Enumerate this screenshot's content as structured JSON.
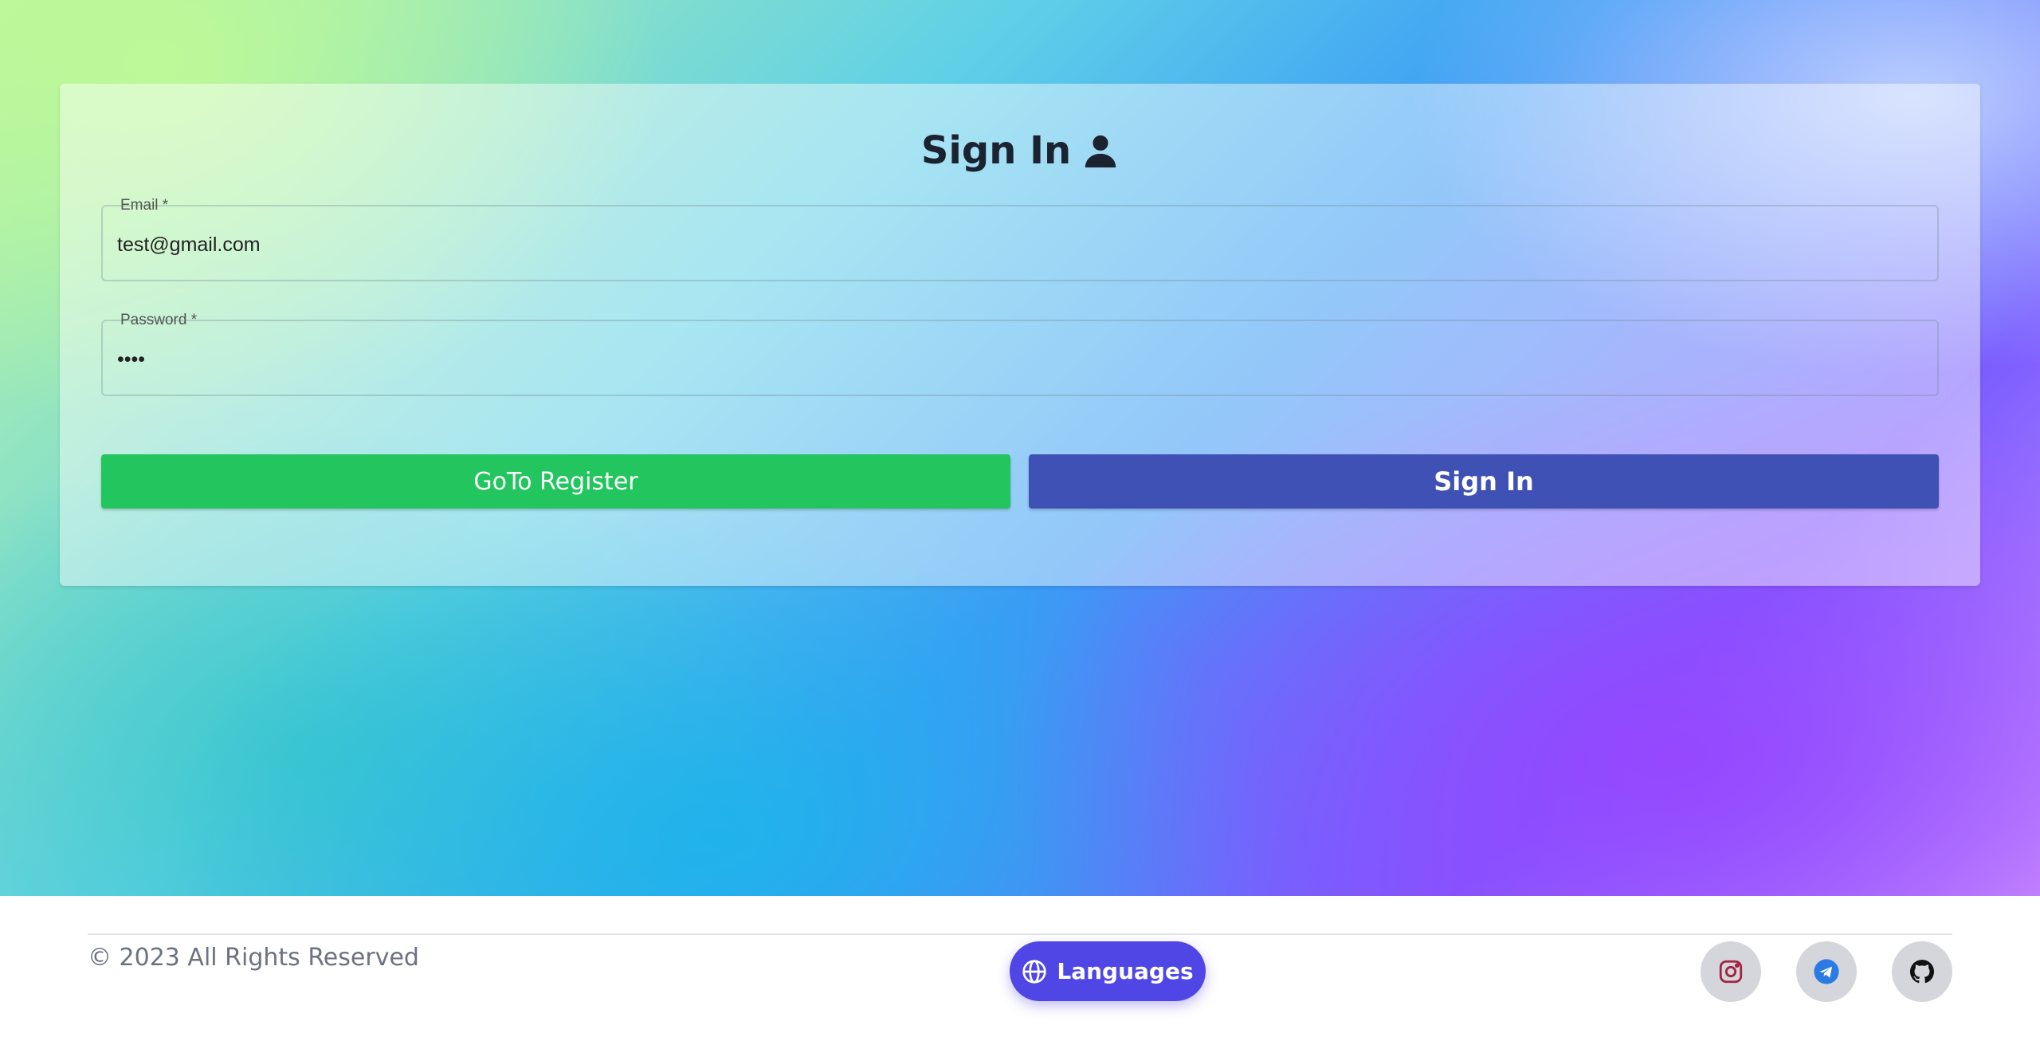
{
  "form": {
    "title": "Sign In",
    "email": {
      "label": "Email *",
      "value": "test@gmail.com"
    },
    "password": {
      "label": "Password *",
      "value": "1234"
    },
    "register_button": "GoTo Register",
    "signin_button": "Sign In"
  },
  "footer": {
    "copyright": "© 2023 All Rights Reserved",
    "languages_button": "Languages",
    "social": [
      "instagram-icon",
      "telegram-icon",
      "github-icon"
    ]
  },
  "colors": {
    "register": "#22c55e",
    "signin": "#3f51b5",
    "languages": "#4f46e5"
  }
}
